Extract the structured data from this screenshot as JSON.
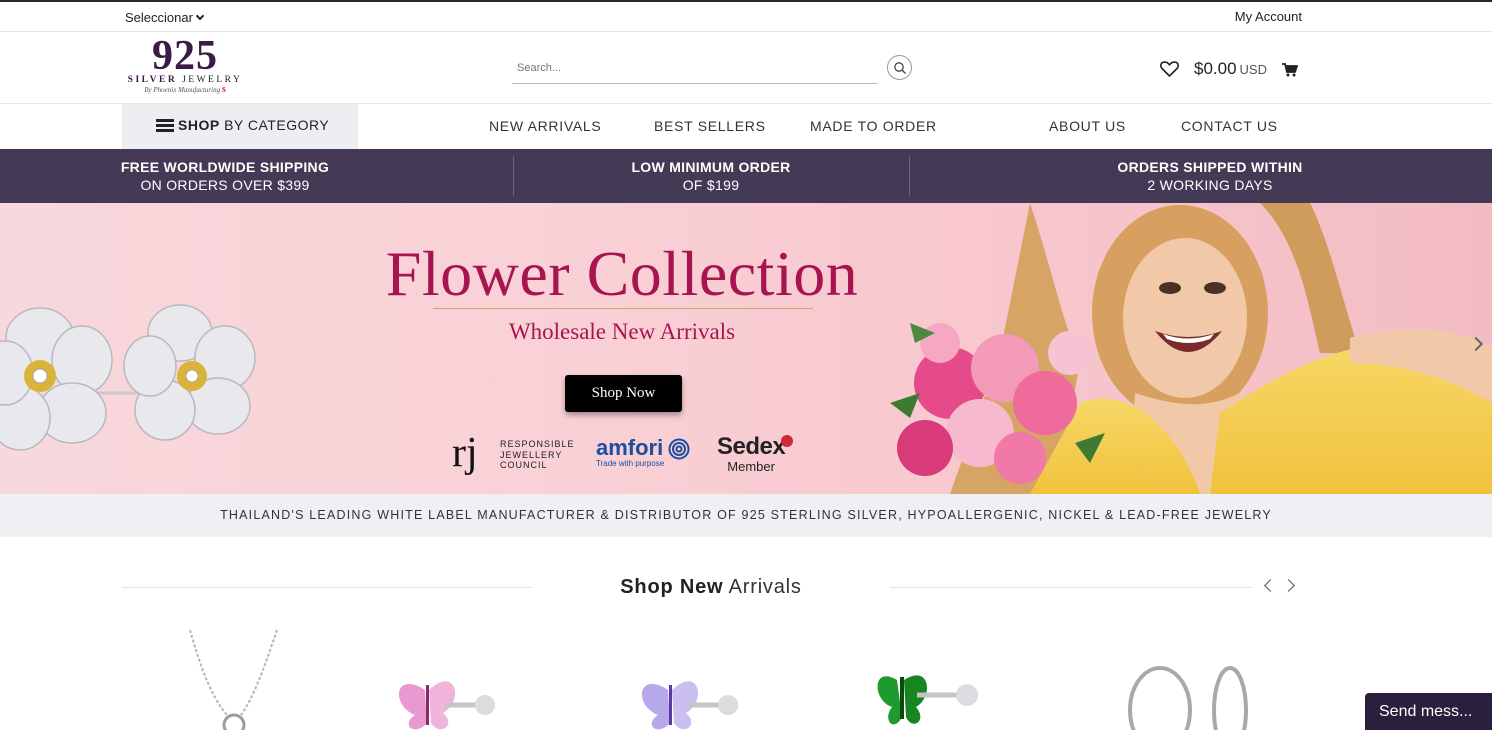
{
  "topbar": {
    "language": "Seleccionar",
    "account": "My Account"
  },
  "logo": {
    "number": "925",
    "line1a": "SILVER",
    "line1b": "JEWELRY",
    "line2": "By Phoenix Manufacturing",
    "mark": "S"
  },
  "search": {
    "placeholder": "Search..."
  },
  "cart": {
    "amount": "$0.00",
    "currency": "USD"
  },
  "nav": {
    "shop_bold": "SHOP",
    "shop_rest": " BY CATEGORY",
    "links": [
      "NEW ARRIVALS",
      "BEST SELLERS",
      "MADE TO ORDER",
      "ABOUT US",
      "CONTACT US"
    ]
  },
  "promo": [
    {
      "line1": "FREE WORLDWIDE SHIPPING",
      "line2": "ON ORDERS OVER $399"
    },
    {
      "line1": "LOW MINIMUM ORDER",
      "line2": "OF $199"
    },
    {
      "line1": "ORDERS SHIPPED WITHIN",
      "line2": "2 WORKING DAYS"
    }
  ],
  "hero": {
    "title": "Flower Collection",
    "subtitle": "Wholesale New Arrivals",
    "cta": "Shop Now",
    "badges": {
      "rjc_mark": "rj",
      "rjc_l1": "RESPONSIBLE",
      "rjc_l2": "JEWELLERY",
      "rjc_l3": "COUNCIL",
      "amfori": "amfori",
      "amfori_tag": "Trade with purpose",
      "sedex": "Sedex",
      "sedex_member": "Member"
    }
  },
  "tagline": "THAILAND'S LEADING WHITE LABEL MANUFACTURER & DISTRIBUTOR OF 925 STERLING SILVER, HYPOALLERGENIC, NICKEL & LEAD-FREE JEWELRY",
  "section": {
    "title_bold": "Shop New",
    "title_rest": " Arrivals"
  },
  "chat": "Send mess...",
  "colors": {
    "promo_bg": "#453a55",
    "hero_accent": "#a81450",
    "chat_bg": "#2a1f3d"
  }
}
